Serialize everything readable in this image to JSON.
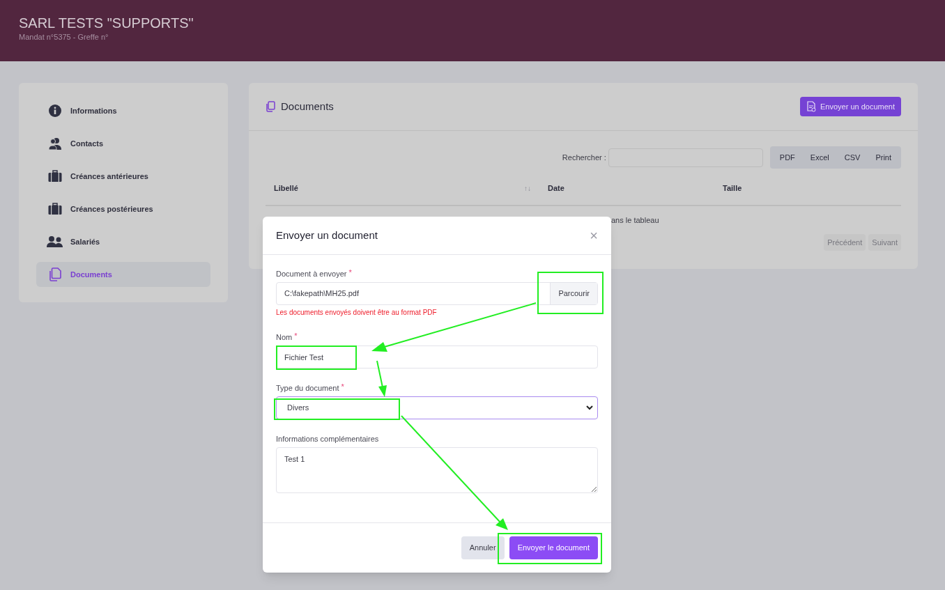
{
  "header": {
    "title": "SARL TESTS \"SUPPORTS\"",
    "subtitle": "Mandat n°5375 - Greffe n°"
  },
  "sidebar": {
    "items": [
      {
        "label": "Informations",
        "kind": "info",
        "selected": false
      },
      {
        "label": "Contacts",
        "kind": "contacts",
        "selected": false
      },
      {
        "label": "Créances antérieures",
        "kind": "briefcase",
        "selected": false
      },
      {
        "label": "Créances postérieures",
        "kind": "briefcase",
        "selected": false
      },
      {
        "label": "Salariés",
        "kind": "users",
        "selected": false
      },
      {
        "label": "Documents",
        "kind": "documents",
        "selected": true
      }
    ]
  },
  "panel": {
    "title": "Documents",
    "action": "Envoyer un document",
    "search_label": "Rechercher :",
    "export_buttons": [
      "PDF",
      "Excel",
      "CSV",
      "Print"
    ],
    "table": {
      "columns": [
        {
          "label": "Libellé",
          "sort": "↑↓"
        },
        {
          "label": "Date"
        },
        {
          "label": "Taille"
        }
      ],
      "empty_text": "ans le tableau"
    },
    "pagination": [
      "Précédent",
      "Suivant"
    ]
  },
  "modal": {
    "title": "Envoyer un document",
    "close": "×",
    "fields": [
      {
        "kind": "file",
        "label": "Document à envoyer",
        "required_mark": "*",
        "value": "C:\\fakepath\\MH25.pdf",
        "button": "Parcourir",
        "hint": "Les documents envoyés doivent être au format PDF"
      },
      {
        "kind": "text",
        "label": "Nom",
        "required_mark": "*",
        "value": "Fichier Test"
      },
      {
        "kind": "select",
        "label": "Type du document",
        "required_mark": "*",
        "value": "Divers"
      },
      {
        "kind": "textarea",
        "label": "Informations complémentaires",
        "value": "Test 1"
      }
    ],
    "buttons": [
      {
        "label": "Annuler",
        "kind": "secondary"
      },
      {
        "label": "Envoyer le document",
        "kind": "primary"
      }
    ]
  }
}
